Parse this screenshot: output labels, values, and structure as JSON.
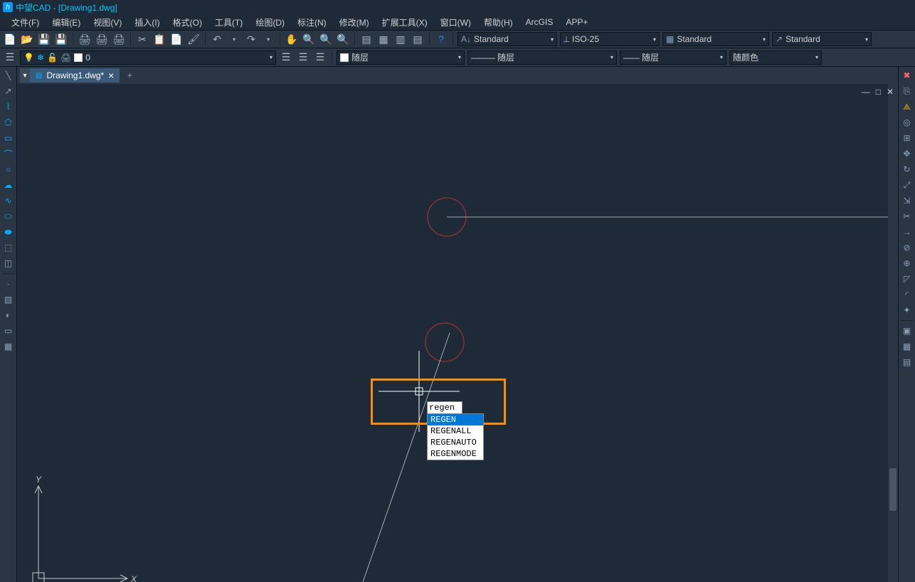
{
  "titlebar": {
    "app": "中望CAD",
    "doc": "[Drawing1.dwg]"
  },
  "menubar": [
    "文件(F)",
    "编辑(E)",
    "视图(V)",
    "插入(I)",
    "格式(O)",
    "工具(T)",
    "绘图(D)",
    "标注(N)",
    "修改(M)",
    "扩展工具(X)",
    "窗口(W)",
    "帮助(H)",
    "ArcGIS",
    "APP+"
  ],
  "toolbar1": {
    "styles": {
      "textstyle": "Standard",
      "dimstyle": "ISO-25",
      "tablestyle": "Standard",
      "mleaderstyle": "Standard"
    }
  },
  "layer_row": {
    "layer_name": "0",
    "linetype": "随层",
    "lineweight": "随层",
    "plotstyle": "随层",
    "color": "随颜色"
  },
  "file_tab": {
    "name": "Drawing1.dwg*"
  },
  "command": {
    "input": "regen",
    "suggestions": [
      "REGEN",
      "REGENALL",
      "REGENAUTO",
      "REGENMODE"
    ],
    "selected_index": 0
  },
  "ucs": {
    "x": "X",
    "y": "Y"
  }
}
